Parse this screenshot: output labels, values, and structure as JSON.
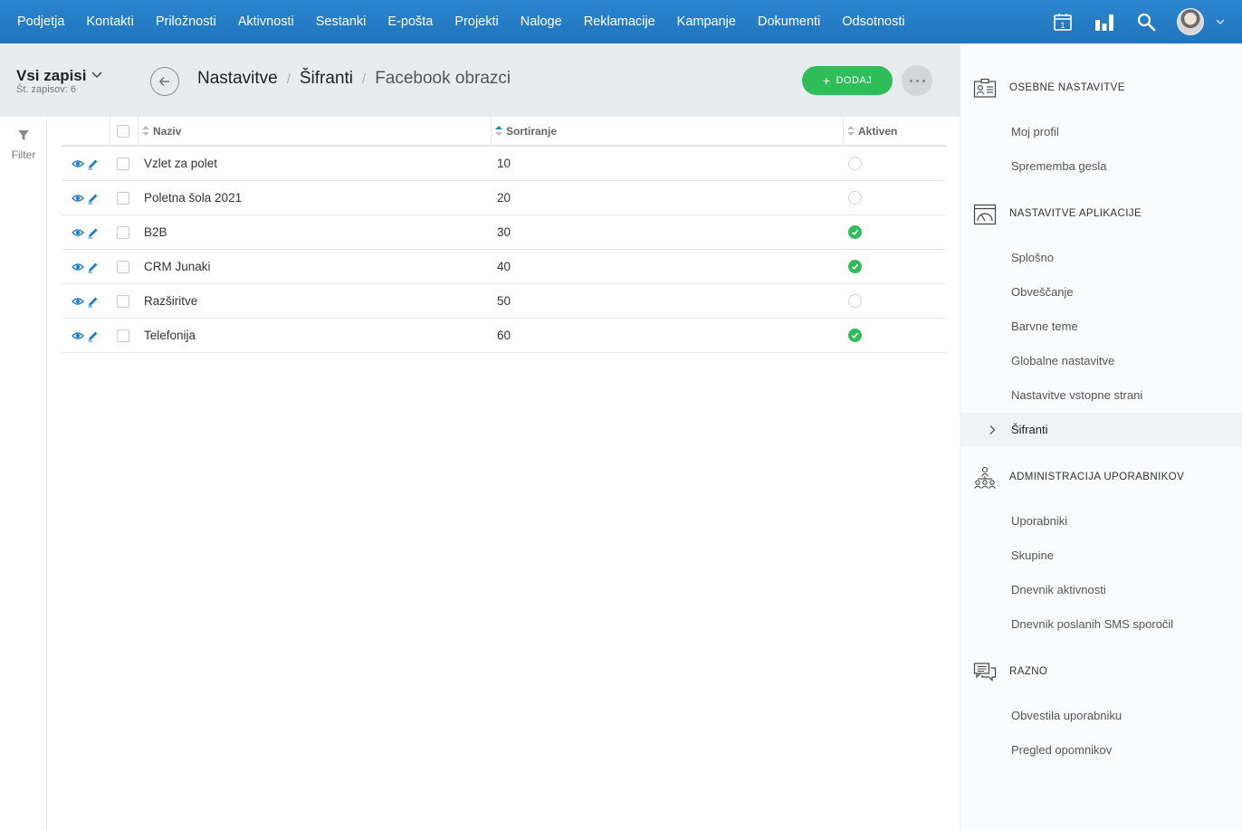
{
  "nav": {
    "items": [
      "Podjetja",
      "Kontakti",
      "Priložnosti",
      "Aktivnosti",
      "Sestanki",
      "E-pošta",
      "Projekti",
      "Naloge",
      "Reklamacije",
      "Kampanje",
      "Dokumenti",
      "Odsotnosti"
    ],
    "calendar_day": "1"
  },
  "header": {
    "view_title": "Vsi zapisi",
    "record_count": "Št. zapisov: 6",
    "breadcrumb": [
      "Nastavitve",
      "Šifranti",
      "Facebook obrazci"
    ],
    "add_label": "DODAJ"
  },
  "filter": {
    "label": "Filter"
  },
  "table": {
    "columns": [
      "Naziv",
      "Sortiranje",
      "Aktiven"
    ],
    "rows": [
      {
        "name": "Vzlet za polet",
        "sort": "10",
        "active": false
      },
      {
        "name": "Poletna šola 2021",
        "sort": "20",
        "active": false
      },
      {
        "name": "B2B",
        "sort": "30",
        "active": true
      },
      {
        "name": "CRM Junaki",
        "sort": "40",
        "active": true
      },
      {
        "name": "Razširitve",
        "sort": "50",
        "active": false
      },
      {
        "name": "Telefonija",
        "sort": "60",
        "active": true
      }
    ]
  },
  "sidebar": {
    "sections": [
      {
        "title": "OSEBNE NASTAVITVE",
        "icon": "id-card-icon",
        "items": [
          "Moj profil",
          "Sprememba gesla"
        ]
      },
      {
        "title": "NASTAVITVE APLIKACIJE",
        "icon": "gauge-window-icon",
        "items": [
          "Splošno",
          "Obveščanje",
          "Barvne teme",
          "Globalne nastavitve",
          "Nastavitve vstopne strani",
          "Šifranti"
        ]
      },
      {
        "title": "ADMINISTRACIJA UPORABNIKOV",
        "icon": "users-hierarchy-icon",
        "items": [
          "Uporabniki",
          "Skupine",
          "Dnevnik aktivnosti",
          "Dnevnik poslanih SMS sporočil"
        ]
      },
      {
        "title": "RAZNO",
        "icon": "chat-bubbles-icon",
        "items": [
          "Obvestila uporabniku",
          "Pregled opomnikov"
        ]
      }
    ],
    "active_item": "Šifranti"
  },
  "colors": {
    "nav_bg": "#2079c2",
    "accent_green": "#2ebd59",
    "action_blue": "#1f7fc6"
  }
}
